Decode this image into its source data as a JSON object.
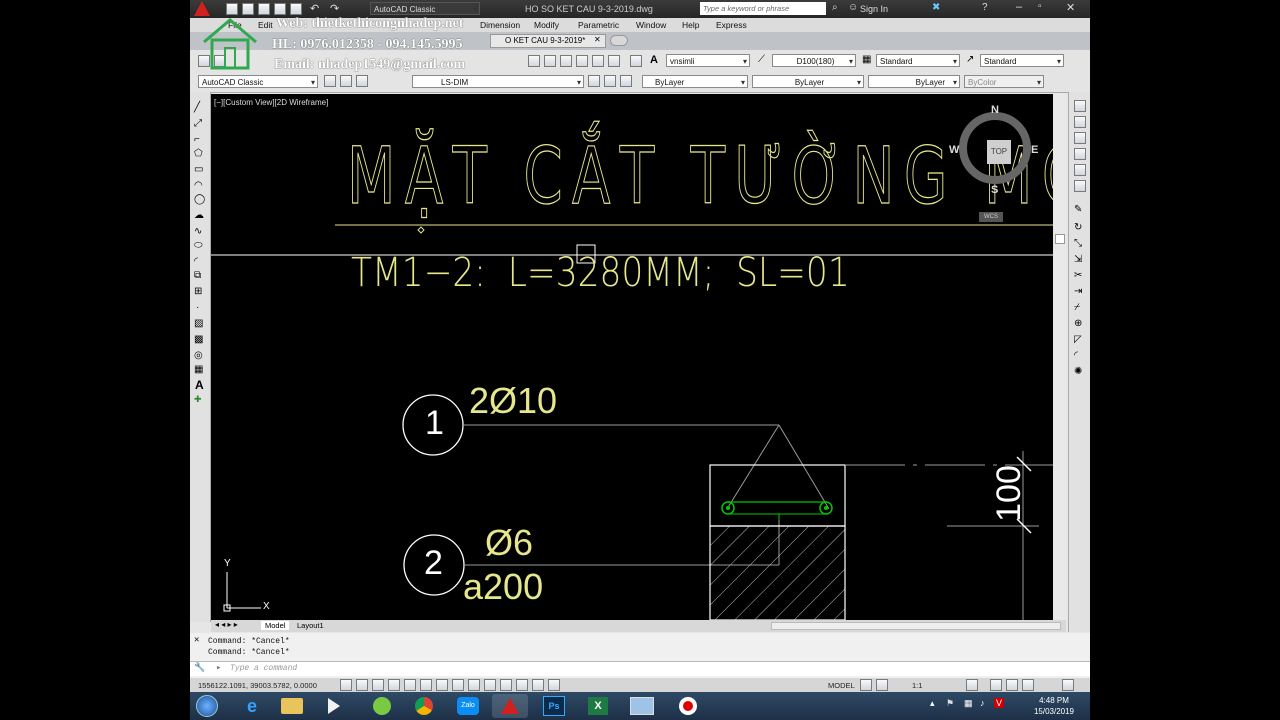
{
  "window": {
    "workspace": "AutoCAD Classic",
    "file_title": "HO SO KET CAU 9-3-2019.dwg",
    "search_placeholder": "Type a keyword or phrase",
    "sign_in": "Sign In"
  },
  "watermark": {
    "web": "Web: thietkethicongnhadep.net",
    "phone": "HL: 0976.012358 - 094.145.5995",
    "email": "Email: nhadep1549@gmail.com"
  },
  "menu": [
    "File",
    "Edit",
    "Dimension",
    "Modify",
    "Parametric",
    "Window",
    "Help",
    "Express"
  ],
  "doc_tab": "O KET CAU 9-3-2019*",
  "toolbar": {
    "text_style": "vnsimli",
    "dim_style": "D100(180)",
    "table_style": "Standard",
    "mleader_style": "Standard",
    "workspace_combo": "AutoCAD Classic",
    "layer": "LS-DIM",
    "color": "ByLayer",
    "linetype": "ByLayer",
    "lineweight": "ByLayer",
    "plotstyle": "ByColor"
  },
  "viewport": {
    "label": "[−][Custom View][2D Wireframe]",
    "title_text": "MẶT CẮT TƯỜNG MÓ",
    "subtitle_text": "TM1−2:  L=3280MM;  SL=01",
    "marker_1": "1",
    "marker_1_label": "2Ø10",
    "marker_2": "2",
    "marker_2_label_a": "Ø6",
    "marker_2_label_b": "a200",
    "dim_value": "100",
    "ucs_x": "X",
    "ucs_y": "Y"
  },
  "viewcube": {
    "n": "N",
    "s": "S",
    "e": "E",
    "w": "W",
    "face": "TOP",
    "wcs": "WCS"
  },
  "layout_tabs": [
    "Model",
    "Layout1"
  ],
  "command": {
    "history": [
      "Command: *Cancel*",
      "Command: *Cancel*"
    ],
    "placeholder": "Type a command"
  },
  "status": {
    "coords": "1556122.1091, 39003.5782, 0.0000",
    "model": "MODEL",
    "scale": "1:1"
  },
  "taskbar": {
    "time": "4:48 PM",
    "date": "15/03/2019",
    "zalo": "Zalo"
  },
  "colors": {
    "drawing_yellow": "#e6e68c",
    "marker_white": "#ffffff",
    "rebar_green": "#00c800",
    "canvas": "#000000"
  }
}
